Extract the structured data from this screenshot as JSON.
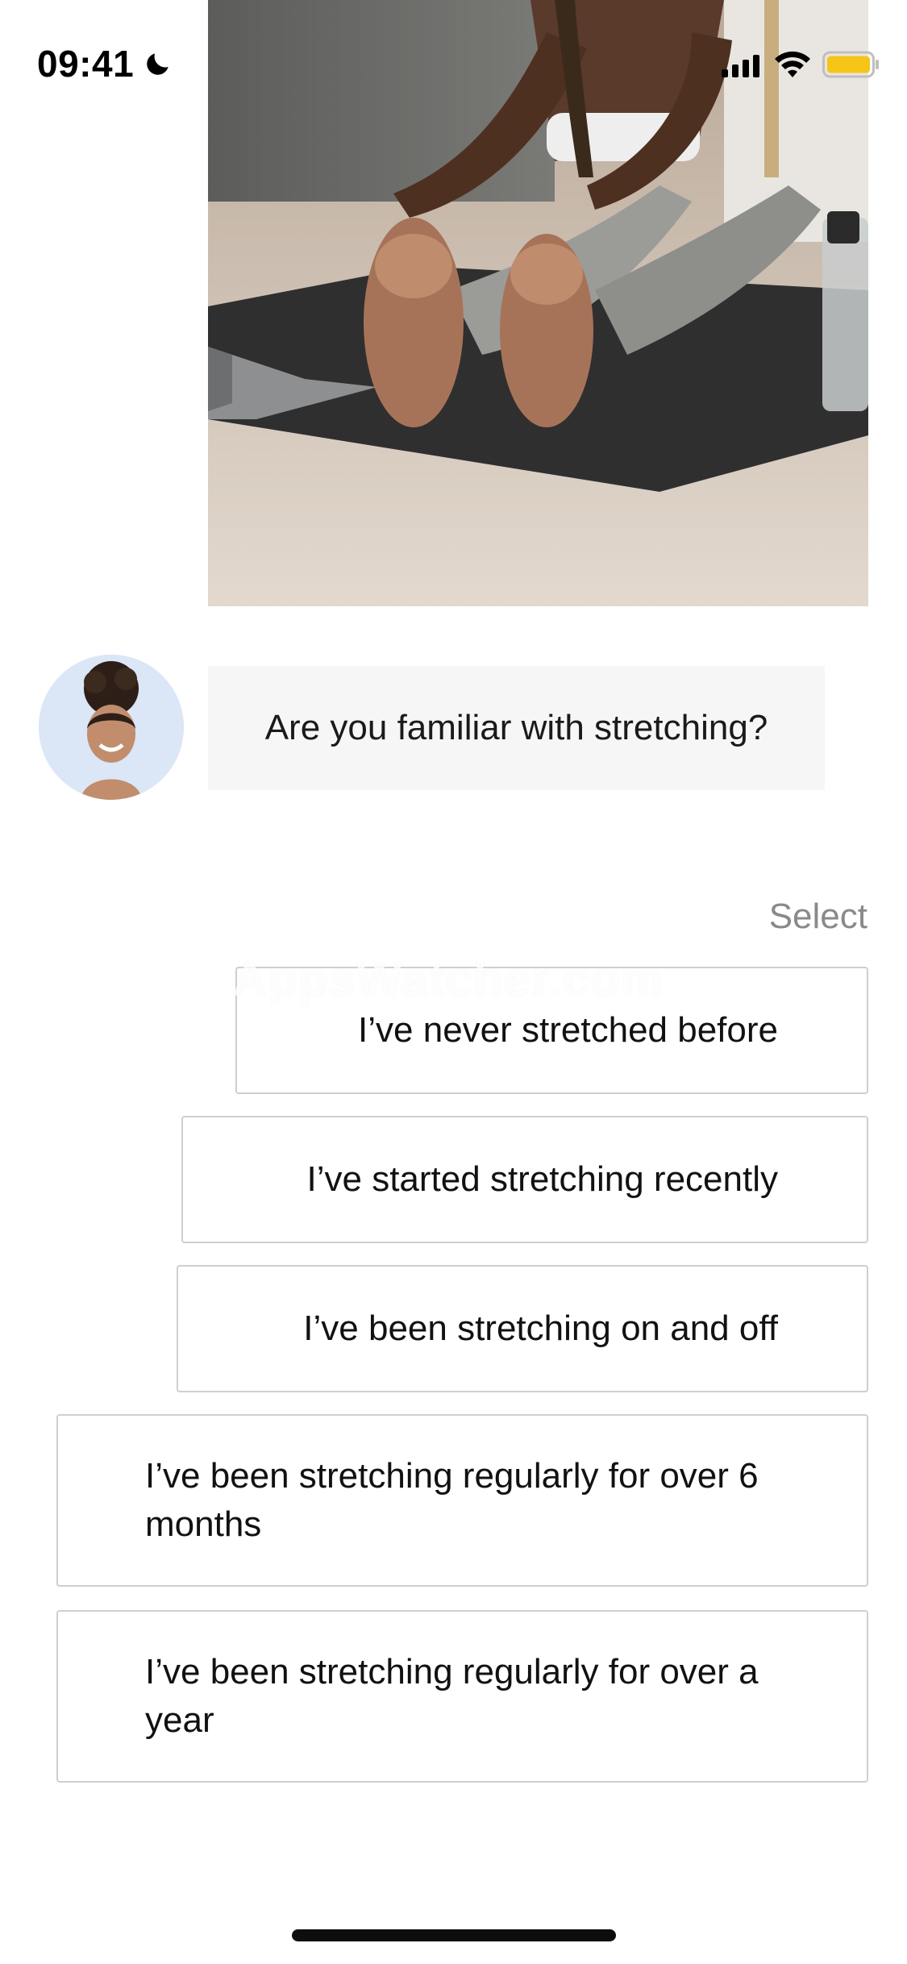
{
  "status_bar": {
    "time": "09:41",
    "icons": [
      "moon-icon",
      "cellular-signal-icon",
      "wifi-icon",
      "battery-icon"
    ],
    "battery_color": "#f5c518"
  },
  "hero": {
    "image": "woman-stretching-on-yoga-mat-photo"
  },
  "chat": {
    "avatar": "coach-avatar-photo",
    "avatar_bg": "#dbe6f7",
    "question": "Are you familiar with stretching?"
  },
  "answers": {
    "select_label": "Select",
    "options": [
      "I’ve never stretched before",
      "I’ve started stretching recently",
      "I’ve been stretching on and off",
      "I’ve been stretching regularly for over 6 months",
      "I’ve been stretching regularly for over a year"
    ]
  },
  "watermark": "AppsWatcher.com"
}
